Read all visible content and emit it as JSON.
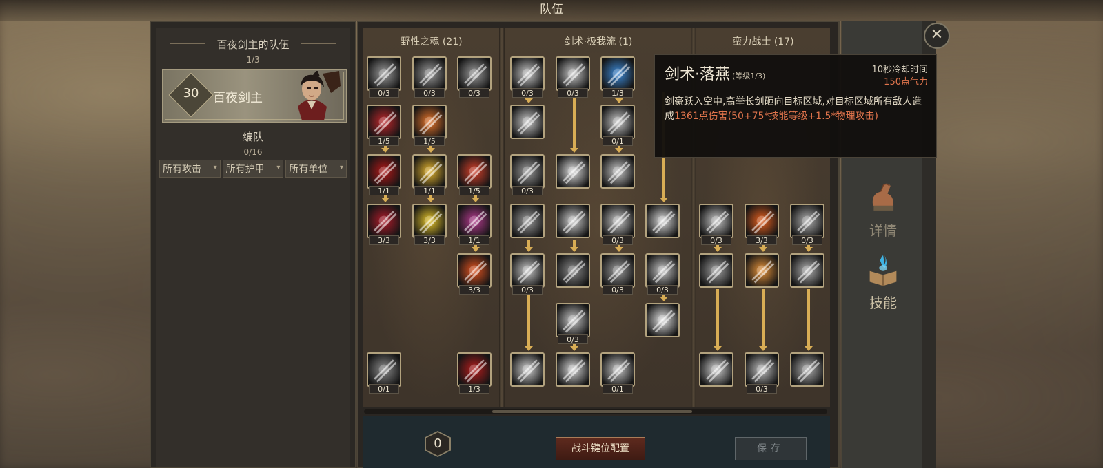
{
  "window_title": "队伍",
  "left": {
    "team_title": "百夜剑主的队伍",
    "team_count": "1/3",
    "hero": {
      "level": "30",
      "name": "百夜剑主"
    },
    "formation_title": "编队",
    "formation_count": "0/16",
    "filters": [
      "所有攻击",
      "所有护甲",
      "所有单位"
    ]
  },
  "columns": [
    "野性之魂 (21)",
    "剑术·极我流 (1)",
    "蛮力战士 (17)"
  ],
  "skills": [
    {
      "icon": "shadow-burst-icon",
      "level": "0/3",
      "color": "#9a9a9a"
    },
    {
      "icon": "claw-strike-icon",
      "level": "0/3",
      "color": "#9a9a9a"
    },
    {
      "icon": "paw-print-icon",
      "level": "0/3",
      "color": "#9a9a9a"
    },
    {
      "icon": "spider-web-icon",
      "level": "1/5",
      "color": "#c0262b"
    },
    {
      "icon": "flame-wing-icon",
      "level": "1/5",
      "color": "#e8752a"
    },
    {
      "icon": "blood-hand-icon",
      "level": "1/1",
      "color": "#b21818"
    },
    {
      "icon": "golden-whirl-icon",
      "level": "1/1",
      "color": "#e5b52e"
    },
    {
      "icon": "fire-dragon-icon",
      "level": "1/5",
      "color": "#d6402a"
    },
    {
      "icon": "blood-splat-icon",
      "level": "3/3",
      "color": "#b01b2a"
    },
    {
      "icon": "golden-coil-icon",
      "level": "3/3",
      "color": "#e7c629"
    },
    {
      "icon": "purple-demon-icon",
      "level": "1/1",
      "color": "#b43a8e"
    },
    {
      "icon": "fire-spiral-icon",
      "level": "3/3",
      "color": "#e2521f"
    },
    {
      "icon": "beast-silhouette-icon",
      "level": "0/1",
      "color": "#8a8a8a"
    },
    {
      "icon": "crimson-slash-icon",
      "level": "1/3",
      "color": "#b51c1c"
    },
    {
      "icon": "blade-fan-icon",
      "level": "0/3",
      "color": "#c7c7c7"
    },
    {
      "icon": "sword-thrust-icon",
      "level": "0/3",
      "color": "#c7c7c7"
    },
    {
      "icon": "ice-crystal-icon",
      "level": "1/3",
      "color": "#3c8ad8"
    },
    {
      "icon": "sword-slash-icon",
      "level": "",
      "color": "#c7c7c7"
    },
    {
      "icon": "sword-eye-icon",
      "level": "0/1",
      "color": "#c7c7c7"
    },
    {
      "icon": "armored-warrior-icon",
      "level": "0/3",
      "color": "#9a9a9a"
    },
    {
      "icon": "star-burst-icon",
      "level": "",
      "color": "#e0e0e0"
    },
    {
      "icon": "spirit-face-icon",
      "level": "",
      "color": "#c7c7c7"
    },
    {
      "icon": "demon-mask-icon",
      "level": "",
      "color": "#9a9a9a"
    },
    {
      "icon": "cross-slash-icon",
      "level": "",
      "color": "#d0d0d0"
    },
    {
      "icon": "triple-slash-icon",
      "level": "0/3",
      "color": "#c7c7c7"
    },
    {
      "icon": "heart-icon",
      "level": "",
      "color": "#dcdcdc"
    },
    {
      "icon": "downward-blade-icon",
      "level": "0/3",
      "color": "#c7c7c7"
    },
    {
      "icon": "vortex-icon",
      "level": "",
      "color": "#8a8a8a"
    },
    {
      "icon": "fist-icon",
      "level": "0/3",
      "color": "#9a9a9a"
    },
    {
      "icon": "crescent-slash-icon",
      "level": "0/3",
      "color": "#c7c7c7"
    },
    {
      "icon": "dagger-drop-icon",
      "level": "0/3",
      "color": "#c7c7c7"
    },
    {
      "icon": "light-burst-icon",
      "level": "",
      "color": "#e4e4e4"
    },
    {
      "icon": "spin-blade-icon",
      "level": "",
      "color": "#d0d0d0"
    },
    {
      "icon": "radiant-sword-icon",
      "level": "",
      "color": "#d8d8d8"
    },
    {
      "icon": "crossed-swords-icon",
      "level": "0/1",
      "color": "#c7c7c7"
    },
    {
      "icon": "wind-slash-icon",
      "level": "0/3",
      "color": "#c7c7c7"
    },
    {
      "icon": "fire-blade-icon",
      "level": "3/3",
      "color": "#e8601e"
    },
    {
      "icon": "saw-blade-icon",
      "level": "0/3",
      "color": "#b0b0b0"
    },
    {
      "icon": "skull-smash-icon",
      "level": "",
      "color": "#a0a0a0"
    },
    {
      "icon": "flaming-sword-icon",
      "level": "",
      "color": "#e8943a"
    },
    {
      "icon": "war-hammer-icon",
      "level": "",
      "color": "#b0b0b0"
    },
    {
      "icon": "slash-wave-icon",
      "level": "",
      "color": "#d0d0d0"
    },
    {
      "icon": "charge-rush-icon",
      "level": "0/3",
      "color": "#c0c0c0"
    },
    {
      "icon": "war-cry-icon",
      "level": "",
      "color": "#b0b0b0"
    }
  ],
  "bottom": {
    "points": "0",
    "keybind_label": "战斗键位配置",
    "save_label": "保存"
  },
  "tabs": [
    {
      "icon": "flexed-arm-icon",
      "label": "详情"
    },
    {
      "icon": "skill-book-icon",
      "label": "技能"
    }
  ],
  "close_icon": "close-icon",
  "close_symbol": "✕",
  "tooltip": {
    "name": "剑术·落燕",
    "level": "(等级1/3)",
    "cooldown": "10秒冷却时间",
    "cost": "150点气力",
    "desc_a": "剑豪跃入空中,高举长剑砸向目标区域,对目标区域所有敌人造成",
    "desc_hl": "1361点伤害(50+75*技能等级+1.5*物理攻击)"
  },
  "colors": {
    "accent": "#d8ad55",
    "highlight": "#e0744c"
  }
}
